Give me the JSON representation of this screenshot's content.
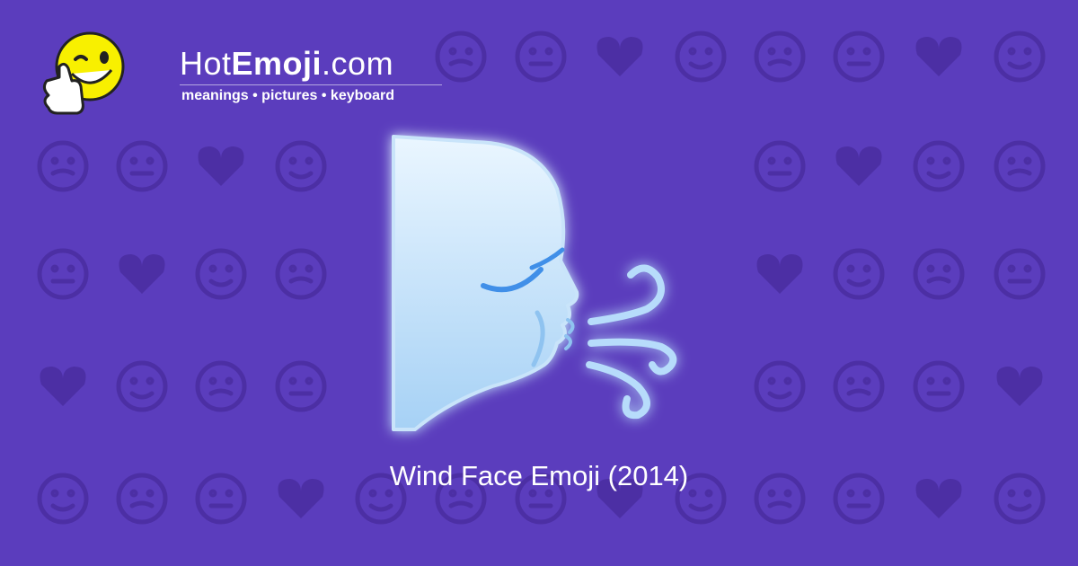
{
  "brand": {
    "prefix": "Hot",
    "bold": "Emoji",
    "suffix": ".com",
    "tagline": "meanings • pictures • keyboard"
  },
  "hero": {
    "icon": "wind-face-icon",
    "caption": "Wind Face Emoji (2014)"
  },
  "background": {
    "color": "#5b3dbd",
    "pattern_color": "#4c2fa4"
  },
  "colors": {
    "face_light": "#eaf6ff",
    "face_dark": "#a6d1f5",
    "eyelash": "#3f8fe8",
    "wind": "#b7dcfb",
    "logo_yellow": "#f8f000"
  }
}
